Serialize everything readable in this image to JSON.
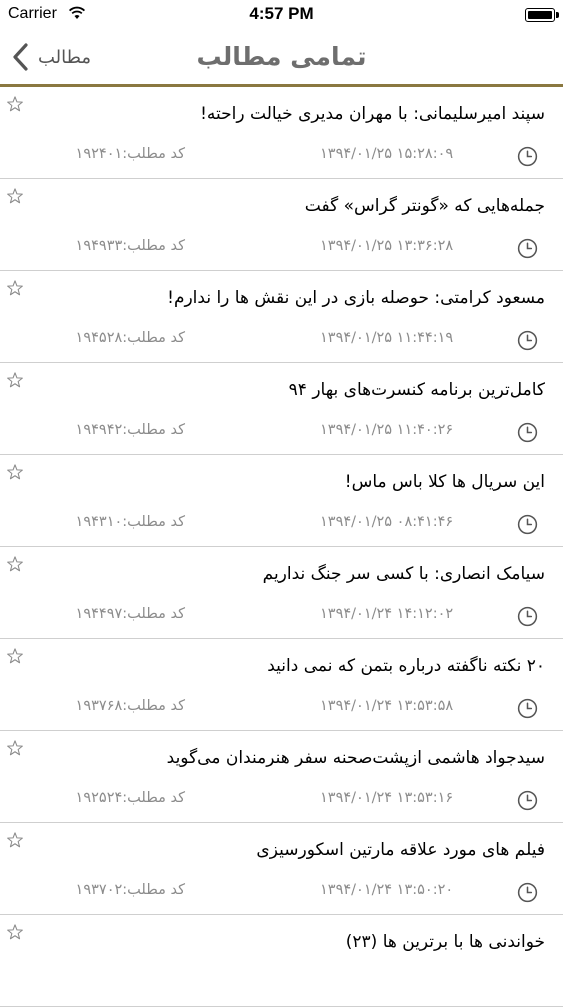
{
  "status_bar": {
    "carrier": "Carrier",
    "time": "4:57 PM"
  },
  "nav": {
    "title": "تمامی مطالب",
    "back_label": "مطالب"
  },
  "items": [
    {
      "title": "سپند امیرسلیمانی: با مهران مدیری خیالت راحته!",
      "datetime": "۱۳۹۴/۰۱/۲۵ ۱۵:۲۸:۰۹",
      "code": "کد مطلب:۱۹۲۴۰۱"
    },
    {
      "title": "جمله‌هایی که «گونتر گراس» گفت",
      "datetime": "۱۳۹۴/۰۱/۲۵ ۱۳:۳۶:۲۸",
      "code": "کد مطلب:۱۹۴۹۳۳"
    },
    {
      "title": "مسعود کرامتی: حوصله بازی در این نقش ها را ندارم!",
      "datetime": "۱۳۹۴/۰۱/۲۵ ۱۱:۴۴:۱۹",
      "code": "کد مطلب:۱۹۴۵۲۸"
    },
    {
      "title": "کامل‌ترین برنامه کنسرت‌های بهار ۹۴",
      "datetime": "۱۳۹۴/۰۱/۲۵ ۱۱:۴۰:۲۶",
      "code": "کد مطلب:۱۹۴۹۴۲"
    },
    {
      "title": "این سریال ها کلا باس ماس!",
      "datetime": "۱۳۹۴/۰۱/۲۵ ۰۸:۴۱:۴۶",
      "code": "کد مطلب:۱۹۴۳۱۰"
    },
    {
      "title": "سیامک انصاری: با کسی سر جنگ نداریم",
      "datetime": "۱۳۹۴/۰۱/۲۴ ۱۴:۱۲:۰۲",
      "code": "کد مطلب:۱۹۴۴۹۷"
    },
    {
      "title": "۲۰ نکته ناگفته درباره بتمن که نمی دانید",
      "datetime": "۱۳۹۴/۰۱/۲۴ ۱۳:۵۳:۵۸",
      "code": "کد مطلب:۱۹۳۷۶۸"
    },
    {
      "title": "سیدجواد هاشمی ازپشت‌صحنه سفر هنرمندان می‌گوید",
      "datetime": "۱۳۹۴/۰۱/۲۴ ۱۳:۵۳:۱۶",
      "code": "کد مطلب:۱۹۲۵۲۴"
    },
    {
      "title": "فیلم های مورد علاقه مارتین اسکورسیزی",
      "datetime": "۱۳۹۴/۰۱/۲۴ ۱۳:۵۰:۲۰",
      "code": "کد مطلب:۱۹۳۷۰۲"
    },
    {
      "title": "خواندنی ها با برترین ها (۲۳)",
      "datetime": "",
      "code": ""
    }
  ]
}
